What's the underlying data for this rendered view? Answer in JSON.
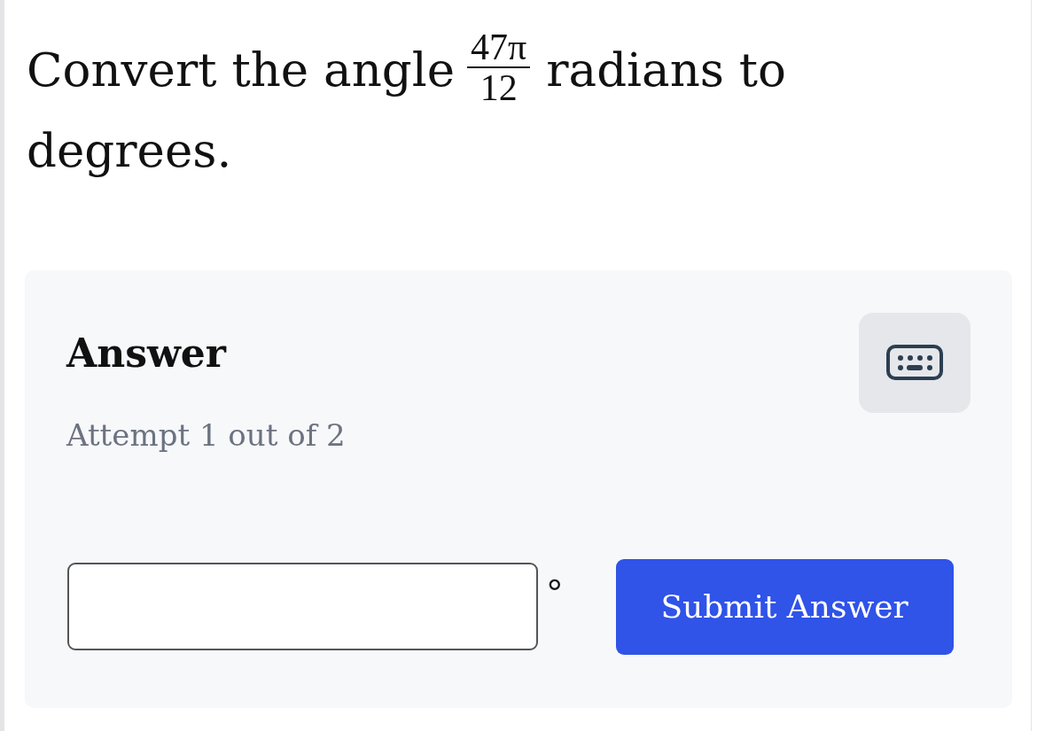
{
  "question": {
    "text_before": "Convert the angle",
    "fraction": {
      "numerator": "47π",
      "denominator": "12"
    },
    "text_after": "radians to degrees."
  },
  "answer_panel": {
    "title": "Answer",
    "attempt": "Attempt 1 out of 2",
    "unit": "°",
    "submit_button": "Submit Answer"
  }
}
